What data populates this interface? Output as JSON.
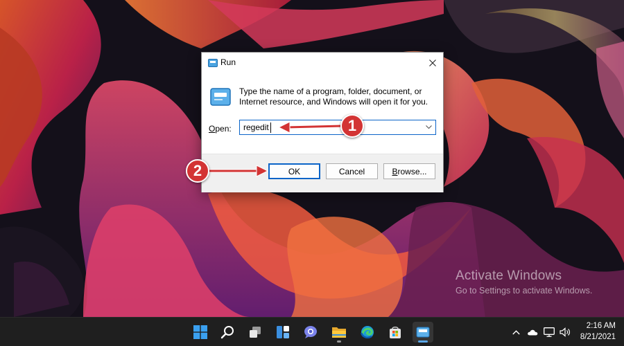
{
  "dialog": {
    "title": "Run",
    "description": "Type the name of a program, folder, document, or Internet resource, and Windows will open it for you.",
    "open_label_underlined": "O",
    "open_label_rest": "pen:",
    "input_value": "regedit",
    "ok_label": "OK",
    "cancel_label": "Cancel",
    "browse_label_underlined": "B",
    "browse_label_rest": "rowse..."
  },
  "annotations": {
    "step1": "1",
    "step2": "2",
    "color": "#d33434"
  },
  "watermark": {
    "title": "Activate Windows",
    "subtitle": "Go to Settings to activate Windows."
  },
  "taskbar": {
    "apps": [
      "windows-start-icon",
      "search-icon",
      "task-view-icon",
      "widgets-icon",
      "teams-chat-icon",
      "file-explorer-icon",
      "edge-icon",
      "microsoft-store-icon",
      "run-app-icon"
    ],
    "tray_icons": [
      "chevron-up-icon",
      "onedrive-cloud-icon",
      "network-icon",
      "volume-icon"
    ],
    "time": "2:16 AM",
    "date": "8/21/2021"
  },
  "colors": {
    "accent": "#0a64c8",
    "taskbar": "#1f1f1f"
  }
}
